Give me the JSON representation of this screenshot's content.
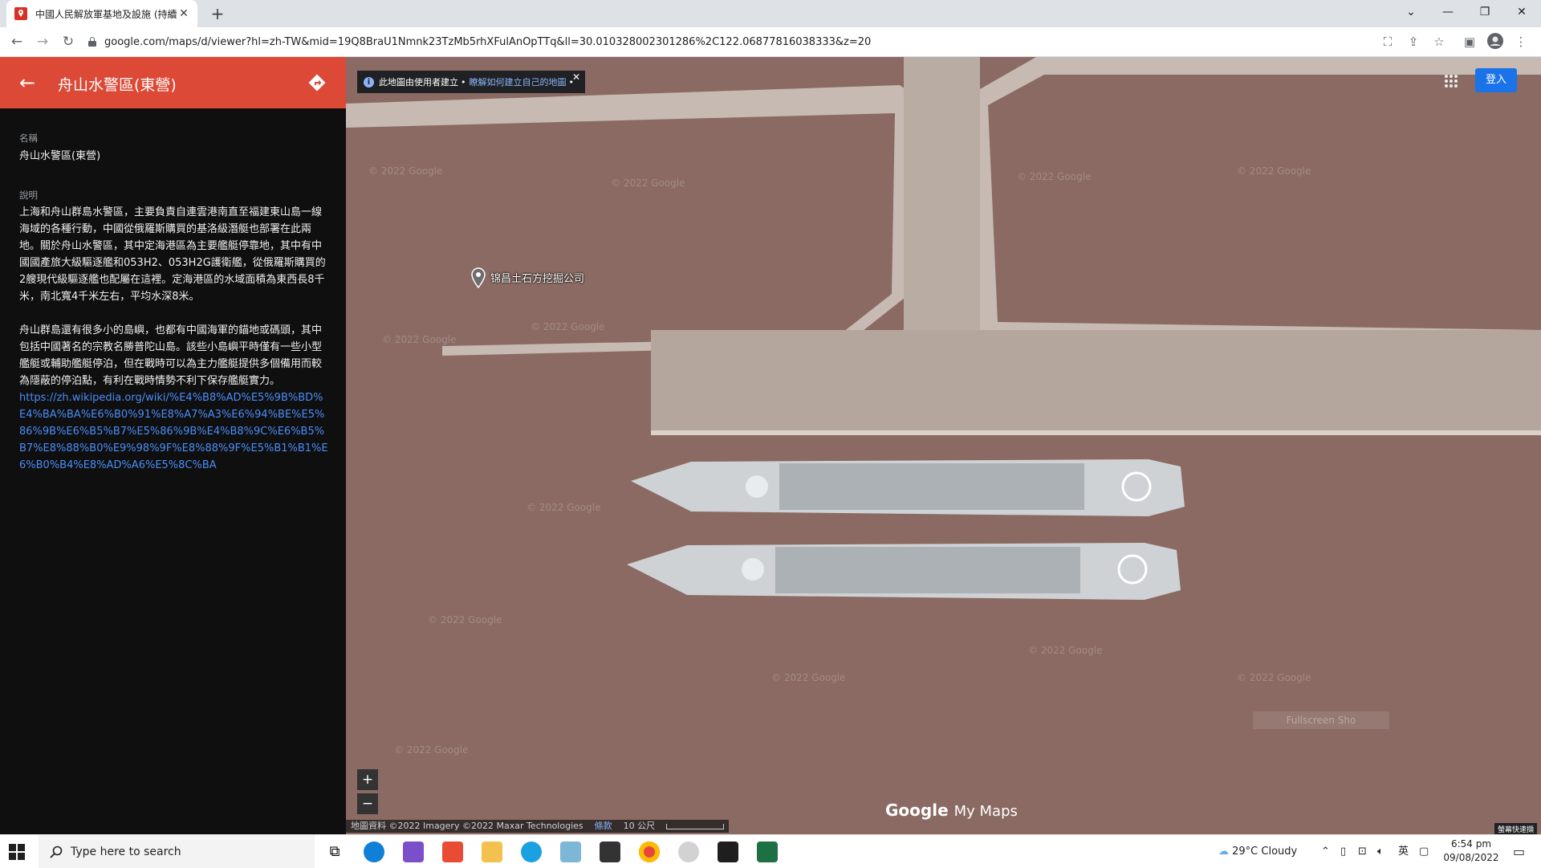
{
  "browser": {
    "tab_title": "中國人民解放軍基地及設施 (持續更新)",
    "new_tab": "+",
    "url": "google.com/maps/d/viewer?hl=zh-TW&mid=19Q8BraU1Nmnk23TzMb5rhXFulAnOpTTq&ll=30.010328002301286%2C122.06877816038333&z=20",
    "window_controls": [
      "⌄",
      "—",
      "❐",
      "✕"
    ]
  },
  "panel": {
    "title": "舟山水警區(東營)",
    "name_label": "名稱",
    "name_value": "舟山水警區(東營)",
    "desc_label": "說明",
    "desc_p1": "上海和舟山群島水警區，主要負責自連雲港南直至福建東山島一線海域的各種行動，中國從俄羅斯購買的基洛級潛艇也部署在此兩地。關於舟山水警區，其中定海港區為主要艦艇停靠地，其中有中國國產旅大級驅逐艦和053H2、053H2G護衛艦，從俄羅斯購買的2艘現代級驅逐艦也配屬在這裡。定海港區的水域面積為東西長8千米，南北寬4千米左右，平均水深8米。",
    "desc_p2": "舟山群島還有很多小的島嶼，也都有中國海軍的錨地或碼頭，其中包括中國著名的宗教名勝普陀山島。該些小島嶼平時僅有一些小型艦艇或輔助艦艇停泊，但在戰時可以為主力艦艇提供多個備用而較為隱蔽的停泊點，有利在戰時情勢不利下保存艦艇實力。",
    "link": "https://zh.wikipedia.org/wiki/%E4%B8%AD%E5%9B%BD%E4%BA%BA%E6%B0%91%E8%A7%A3%E6%94%BE%E5%86%9B%E6%B5%B7%E5%86%9B%E4%B8%9C%E6%B5%B7%E8%88%B0%E9%98%9F%E8%88%9F%E5%B1%B1%E6%B0%B4%E8%AD%A6%E5%8C%BA"
  },
  "map": {
    "info_text": "此地圖由使用者建立",
    "info_link": "瞭解如何建立自己的地圖",
    "signin": "登入",
    "pin_label": "锦昌土石方挖掘公司",
    "zoom_in": "+",
    "zoom_out": "−",
    "logo_google": "Google",
    "logo_mymaps": "My Maps",
    "attribution": "地圖資料 ©2022 Imagery ©2022 Maxar Technologies",
    "terms": "條款",
    "scale": "10 公尺",
    "watermark": "© 2022 Google",
    "overlay_tag": "螢幕快速擷",
    "sat_label": "Fullscreen Sho"
  },
  "taskbar": {
    "search_placeholder": "Type here to search",
    "weather": "29°C  Cloudy",
    "ime": "英",
    "time": "6:54 pm",
    "date": "09/08/2022"
  },
  "colors": {
    "panel_header": "#dc4936",
    "signin_blue": "#1a73e8",
    "water": "#8a6a63",
    "pier": "#b4a69c"
  }
}
